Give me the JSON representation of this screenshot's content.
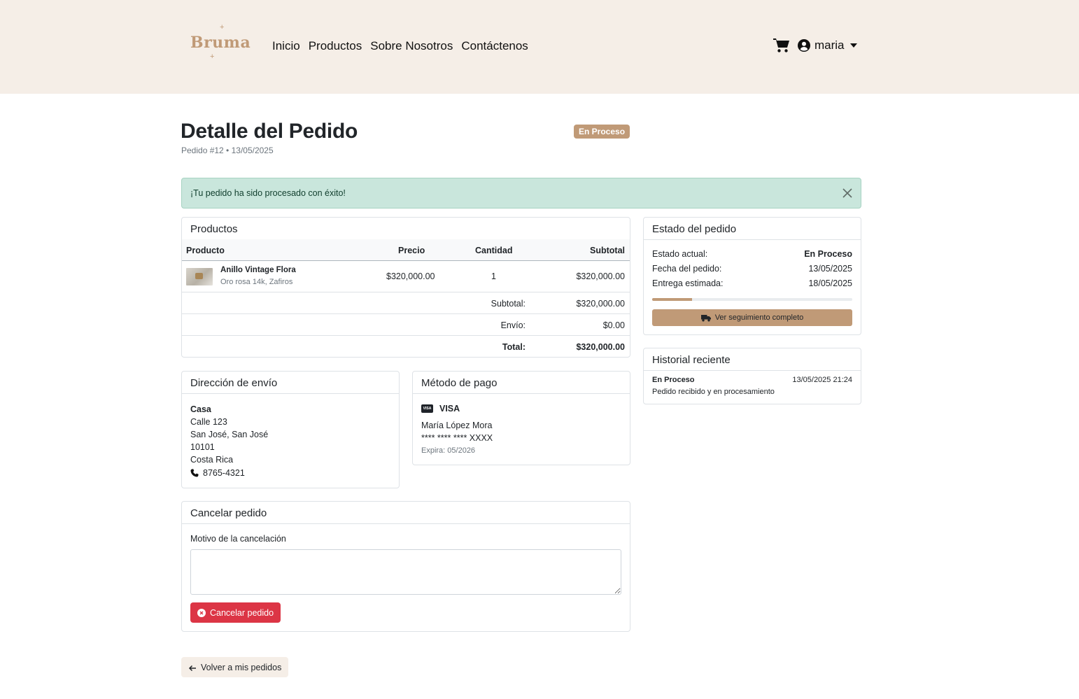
{
  "brand": {
    "name": "Bruma",
    "logo_star": "+"
  },
  "nav": {
    "items": [
      "Inicio",
      "Productos",
      "Sobre Nosotros",
      "Contáctenos"
    ]
  },
  "user": {
    "name": "maria",
    "icons": [
      "cart-icon",
      "user-circle-icon",
      "caret-down-icon"
    ]
  },
  "page": {
    "title": "Detalle del Pedido",
    "subtitle": "Pedido #12 • 13/05/2025",
    "status_badge": "En Proceso"
  },
  "alert": {
    "message": "¡Tu pedido ha sido procesado con éxito!"
  },
  "products": {
    "header": "Productos",
    "columns": [
      "Producto",
      "Precio",
      "Cantidad",
      "Subtotal"
    ],
    "rows": [
      {
        "name": "Anillo Vintage Flora",
        "description": "Oro rosa 14k, Zafiros",
        "price": "$320,000.00",
        "quantity": "1",
        "subtotal": "$320,000.00"
      }
    ],
    "summary": {
      "subtotal_label": "Subtotal:",
      "subtotal_value": "$320,000.00",
      "shipping_label": "Envío:",
      "shipping_value": "$0.00",
      "total_label": "Total:",
      "total_value": "$320,000.00"
    }
  },
  "status_card": {
    "header": "Estado del pedido",
    "current_label": "Estado actual:",
    "current_value": "En Proceso",
    "date_label": "Fecha del pedido:",
    "date_value": "13/05/2025",
    "delivery_label": "Entrega estimada:",
    "delivery_value": "18/05/2025",
    "progress": 0.2,
    "tracking_button": "Ver seguimiento completo"
  },
  "history": {
    "header": "Historial reciente",
    "entries": [
      {
        "status": "En Proceso",
        "datetime": "13/05/2025 21:24",
        "description": "Pedido recibido y en procesamiento"
      }
    ]
  },
  "shipping_address": {
    "header": "Dirección de envío",
    "name": "Casa",
    "lines": [
      "Calle 123",
      "San José, San José",
      "10101",
      "Costa Rica"
    ],
    "phone": "8765-4321"
  },
  "payment": {
    "header": "Método de pago",
    "brand": "VISA",
    "brand_icon_text": "VISA",
    "holder": "María López Mora",
    "number": "**** **** **** XXXX",
    "expiry": "Expira: 05/2026"
  },
  "cancel": {
    "header": "Cancelar pedido",
    "reason_label": "Motivo de la cancelación",
    "reason_value": "",
    "button": "Cancelar pedido"
  },
  "back_button": "Volver a mis pedidos",
  "colors": {
    "accent": "#c09a77",
    "header_bg": "#f5eee7",
    "alert_bg": "#c9e6dc",
    "danger": "#dc3545"
  }
}
